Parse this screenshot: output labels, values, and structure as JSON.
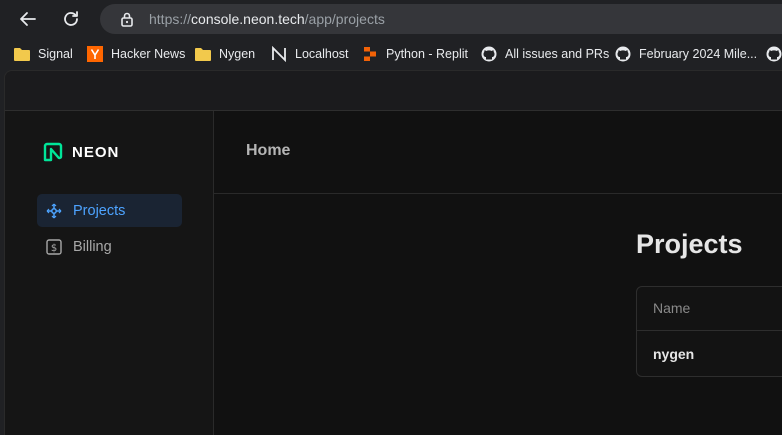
{
  "browser": {
    "url_prefix": "https://",
    "url_domain": "console.neon.tech",
    "url_path": "/app/projects",
    "icons": {
      "back": "back-arrow-icon",
      "reload": "reload-icon",
      "lock": "lock-icon"
    }
  },
  "bookmarks": [
    {
      "label": "Signal",
      "icon": "folder-icon"
    },
    {
      "label": "Hacker News",
      "icon": "hacker-news-icon"
    },
    {
      "label": "Nygen",
      "icon": "folder-icon"
    },
    {
      "label": "Localhost",
      "icon": "localhost-icon"
    },
    {
      "label": "Python - Replit",
      "icon": "replit-icon"
    },
    {
      "label": "All issues and PRs",
      "icon": "github-icon"
    },
    {
      "label": "February 2024 Mile...",
      "icon": "github-icon"
    }
  ],
  "app": {
    "logo_text": "NEON",
    "accent_color": "#4da3ff",
    "logo_color": "#00e599",
    "nav": [
      {
        "label": "Projects",
        "icon": "projects-icon",
        "active": true
      },
      {
        "label": "Billing",
        "icon": "billing-icon",
        "active": false
      }
    ],
    "breadcrumb": "Home",
    "page_title": "Projects",
    "table": {
      "columns": [
        "Name"
      ],
      "rows": [
        [
          "nygen"
        ]
      ]
    }
  }
}
